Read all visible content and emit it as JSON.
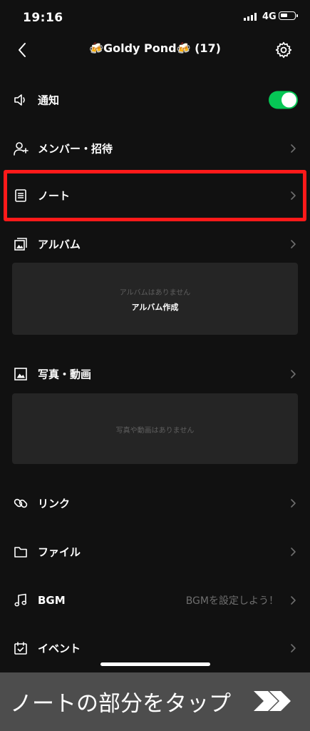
{
  "status_bar": {
    "time": "19:16",
    "network": "4G"
  },
  "header": {
    "title": "🍻Goldy  Pond🍻 (17)"
  },
  "menu": {
    "notifications": {
      "label": "通知",
      "enabled": true
    },
    "members": {
      "label": "メンバー・招待"
    },
    "note": {
      "label": "ノート"
    },
    "album": {
      "label": "アルバム",
      "empty_text": "アルバムはありません",
      "create_label": "アルバム作成"
    },
    "photos": {
      "label": "写真・動画",
      "empty_text": "写真や動画はありません"
    },
    "links": {
      "label": "リンク"
    },
    "files": {
      "label": "ファイル"
    },
    "bgm": {
      "label": "BGM",
      "value": "BGMを設定しよう！"
    },
    "events": {
      "label": "イベント"
    }
  },
  "banner": {
    "text": "ノートの部分をタップ"
  },
  "colors": {
    "toggle_on": "#06c755",
    "highlight": "#ff1a1a",
    "banner_bg": "#4d4d4d"
  }
}
